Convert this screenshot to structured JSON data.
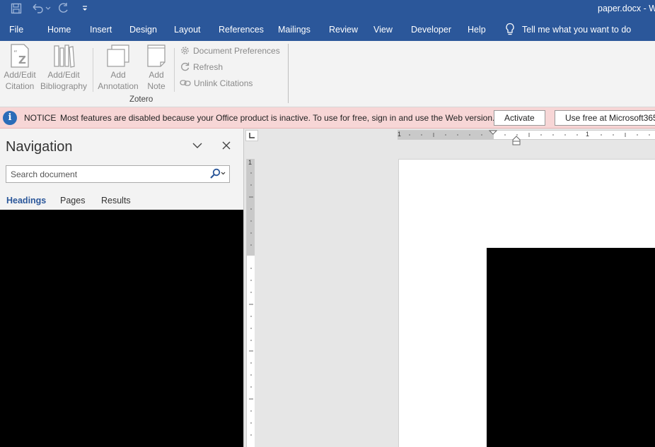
{
  "window": {
    "title": "paper.docx - W"
  },
  "quick_access": {
    "icons": [
      "save-icon",
      "undo-icon",
      "redo-icon",
      "customize-icon"
    ]
  },
  "tabs": [
    "File",
    "Home",
    "Insert",
    "Design",
    "Layout",
    "References",
    "Mailings",
    "Review",
    "View",
    "Developer",
    "Help"
  ],
  "tell_me": {
    "label": "Tell me what you want to do"
  },
  "ribbon": {
    "add_edit_citation": {
      "line1": "Add/Edit",
      "line2": "Citation"
    },
    "add_edit_bibliography": {
      "line1": "Add/Edit",
      "line2": "Bibliography"
    },
    "add_annotation": {
      "line1": "Add",
      "line2": "Annotation"
    },
    "add_note": {
      "line1": "Add",
      "line2": "Note"
    },
    "document_preferences": "Document Preferences",
    "refresh": "Refresh",
    "unlink_citations": "Unlink Citations",
    "group_label": "Zotero"
  },
  "notice": {
    "tag": "NOTICE",
    "message": "Most features are disabled because your Office product is inactive. To use for free, sign in and use the Web version.",
    "activate": "Activate",
    "use_free": "Use free at Microsoft365"
  },
  "navigation": {
    "title": "Navigation",
    "search_placeholder": "Search document",
    "tabs": [
      "Headings",
      "Pages",
      "Results"
    ],
    "active_tab": "Headings"
  },
  "ruler": {
    "h_left_number": "1",
    "h_right_number": "1",
    "v_number": "1"
  },
  "colors": {
    "accent": "#2b579a",
    "notice_bg": "#f7d6d6",
    "info_icon": "#2b6cb8"
  }
}
